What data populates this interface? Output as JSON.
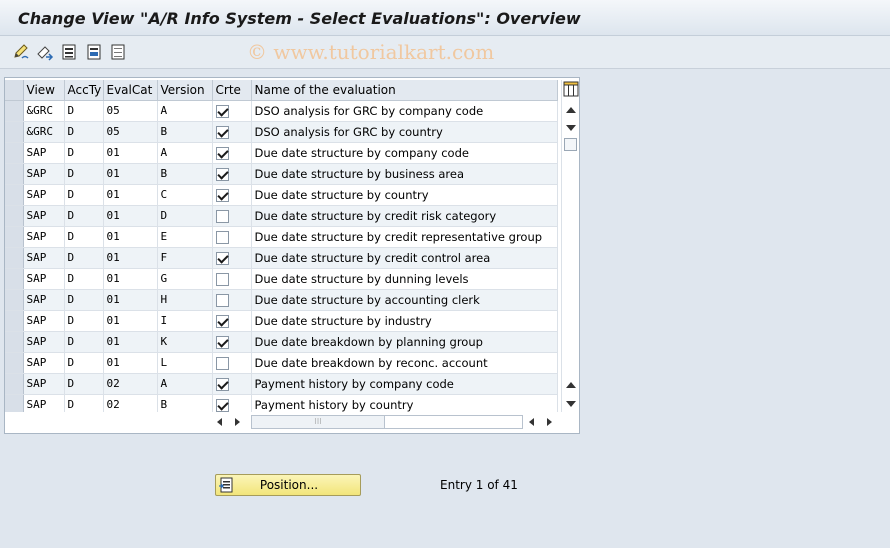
{
  "window": {
    "title": "Change View \"A/R Info System - Select Evaluations\": Overview",
    "watermark": "© www.tutorialkart.com"
  },
  "toolbar": {
    "icons": [
      "edit-pencil-icon",
      "display-change-icon",
      "select-all-icon",
      "select-block-icon",
      "deselect-all-icon"
    ]
  },
  "table": {
    "columns": [
      "View",
      "AccTy",
      "EvalCat",
      "Version",
      "Crte",
      "Name of the evaluation"
    ],
    "rows": [
      {
        "view": "&GRC",
        "accty": "D",
        "evalcat": "05",
        "version": "A",
        "crte": true,
        "name": "DSO analysis for GRC by company code"
      },
      {
        "view": "&GRC",
        "accty": "D",
        "evalcat": "05",
        "version": "B",
        "crte": true,
        "name": "DSO analysis for GRC by country"
      },
      {
        "view": "SAP",
        "accty": "D",
        "evalcat": "01",
        "version": "A",
        "crte": true,
        "name": "Due date structure by company code"
      },
      {
        "view": "SAP",
        "accty": "D",
        "evalcat": "01",
        "version": "B",
        "crte": true,
        "name": "Due date structure by business area"
      },
      {
        "view": "SAP",
        "accty": "D",
        "evalcat": "01",
        "version": "C",
        "crte": true,
        "name": "Due date structure by country"
      },
      {
        "view": "SAP",
        "accty": "D",
        "evalcat": "01",
        "version": "D",
        "crte": false,
        "name": "Due date structure by credit risk category"
      },
      {
        "view": "SAP",
        "accty": "D",
        "evalcat": "01",
        "version": "E",
        "crte": false,
        "name": "Due date structure by credit representative group"
      },
      {
        "view": "SAP",
        "accty": "D",
        "evalcat": "01",
        "version": "F",
        "crte": true,
        "name": "Due date structure by credit control area"
      },
      {
        "view": "SAP",
        "accty": "D",
        "evalcat": "01",
        "version": "G",
        "crte": false,
        "name": "Due date structure by dunning levels"
      },
      {
        "view": "SAP",
        "accty": "D",
        "evalcat": "01",
        "version": "H",
        "crte": false,
        "name": "Due date structure by accounting clerk"
      },
      {
        "view": "SAP",
        "accty": "D",
        "evalcat": "01",
        "version": "I",
        "crte": true,
        "name": "Due date structure by industry"
      },
      {
        "view": "SAP",
        "accty": "D",
        "evalcat": "01",
        "version": "K",
        "crte": true,
        "name": "Due date breakdown by planning group"
      },
      {
        "view": "SAP",
        "accty": "D",
        "evalcat": "01",
        "version": "L",
        "crte": false,
        "name": "Due date breakdown by reconc. account"
      },
      {
        "view": "SAP",
        "accty": "D",
        "evalcat": "02",
        "version": "A",
        "crte": true,
        "name": "Payment history by company code"
      },
      {
        "view": "SAP",
        "accty": "D",
        "evalcat": "02",
        "version": "B",
        "crte": true,
        "name": "Payment history by country"
      }
    ]
  },
  "footer": {
    "position_button": "Position...",
    "entry_text": "Entry 1 of 41"
  }
}
